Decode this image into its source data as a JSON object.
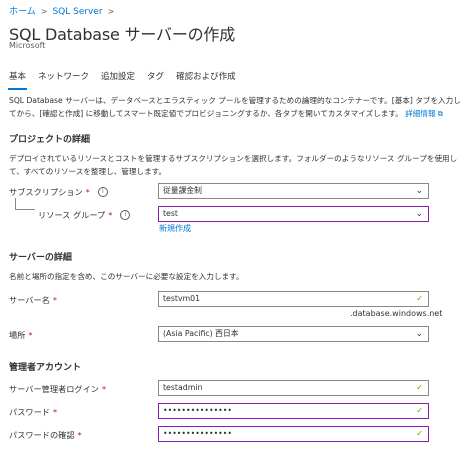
{
  "breadcrumb": {
    "home": "ホーム",
    "sql_server": "SQL Server"
  },
  "page": {
    "title": "SQL Database サーバーの作成",
    "subtitle": "Microsoft"
  },
  "tabs": [
    "基本",
    "ネットワーク",
    "追加設定",
    "タグ",
    "確認および作成"
  ],
  "intro": {
    "text": "SQL Database サーバーは、データベースとエラスティック プールを管理するための論理的なコンテナーです。[基本] タブを入力してから、[確認と作成] に移動してスマート既定値でプロビジョニングするか、各タブを開いてカスタマイズします。",
    "link": "詳細情報"
  },
  "project": {
    "heading": "プロジェクトの詳細",
    "description": "デプロイされているリソースとコストを管理するサブスクリプションを選択します。フォルダーのようなリソース グループを使用して、すべてのリソースを整理し、管理します。",
    "subscription_label": "サブスクリプション",
    "subscription_value": "従量課金制",
    "resource_group_label": "リソース グループ",
    "resource_group_value": "test",
    "create_new": "新規作成"
  },
  "server": {
    "heading": "サーバーの詳細",
    "description": "名前と場所の指定を含め、このサーバーに必要な設定を入力します。",
    "name_label": "サーバー名",
    "name_value": "testvm01",
    "name_suffix": ".database.windows.net",
    "location_label": "場所",
    "location_value": "(Asia Pacific) 西日本"
  },
  "admin": {
    "heading": "管理者アカウント",
    "login_label": "サーバー管理者ログイン",
    "login_value": "testadmin",
    "password_label": "パスワード",
    "password_value": "•••••••••••••••",
    "confirm_label": "パスワードの確認",
    "confirm_value": "•••••••••••••••"
  },
  "required_mark": "*",
  "colors": {
    "accent": "#0078d4",
    "focus_border": "#8a1ab0",
    "valid": "#57a300",
    "required": "#a4262c"
  },
  "icons": {
    "info": "info-icon",
    "dropdown": "chevron-down-icon",
    "valid": "checkmark-icon",
    "external": "external-link-icon"
  }
}
